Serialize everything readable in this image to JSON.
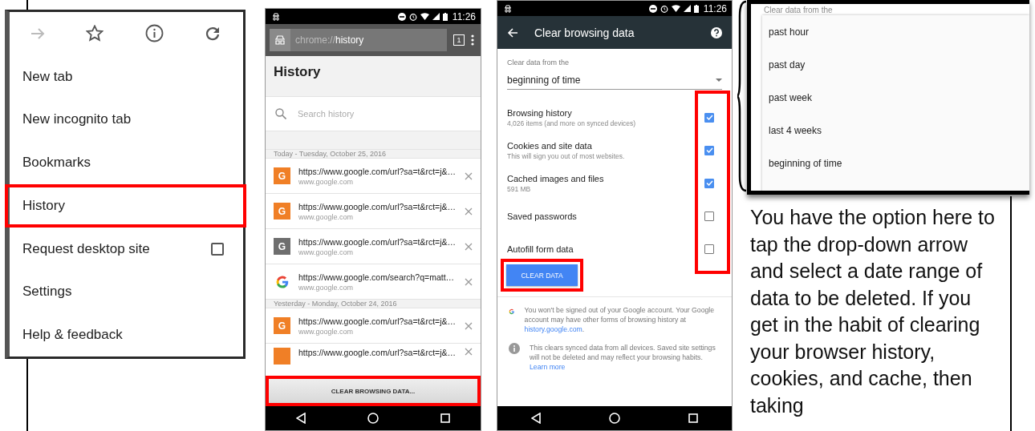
{
  "menu_screen": {
    "toolbar": [
      {
        "kind": "forward",
        "disabled": true
      },
      {
        "kind": "star",
        "disabled": false
      },
      {
        "kind": "info",
        "disabled": false
      },
      {
        "kind": "refresh",
        "disabled": false
      }
    ],
    "items": [
      {
        "label": "New tab",
        "kind": "item",
        "highlighted": false
      },
      {
        "label": "New incognito tab",
        "kind": "item",
        "highlighted": false
      },
      {
        "label": "Bookmarks",
        "kind": "item",
        "highlighted": false
      },
      {
        "label": "History",
        "kind": "item",
        "highlighted": true
      },
      {
        "label": "Request desktop site",
        "kind": "checkbox",
        "checked": false,
        "highlighted": false
      },
      {
        "label": "Settings",
        "kind": "item",
        "highlighted": false
      },
      {
        "label": "Help & feedback",
        "kind": "item",
        "highlighted": false
      }
    ]
  },
  "history_screen": {
    "status_time": "11:26",
    "url_scheme": "chrome://",
    "url_path": "history",
    "tab_count": "1",
    "title": "History",
    "search_placeholder": "Search history",
    "groups": [
      {
        "date": "Today - Tuesday, October 25, 2016",
        "entries": [
          {
            "kind": "letter",
            "letter": "G",
            "color": "#f07f26",
            "url": "https://www.google.com/url?sa=t&rct=j&…",
            "domain": "www.google.com"
          },
          {
            "kind": "letter",
            "letter": "G",
            "color": "#f07f26",
            "url": "https://www.google.com/url?sa=t&rct=j&…",
            "domain": "www.google.com"
          },
          {
            "kind": "letter",
            "letter": "G",
            "color": "#6e6e6e",
            "url": "https://www.google.com/url?sa=t&rct=j&…",
            "domain": "www.google.com"
          },
          {
            "kind": "google",
            "url": "https://www.google.com/search?q=matt…",
            "domain": "www.google.com"
          }
        ]
      },
      {
        "date": "Yesterday - Monday, October 24, 2016",
        "entries": [
          {
            "kind": "letter",
            "letter": "G",
            "color": "#f07f26",
            "url": "https://www.google.com/url?sa=t&rct=j&…",
            "domain": "www.google.com"
          },
          {
            "kind": "letter",
            "color": "#f07f26",
            "url": "https://www.google.com/url?sa=t&rct=j&…"
          }
        ]
      }
    ],
    "footer_button": {
      "label": "CLEAR BROWSING DATA...",
      "highlighted": true
    }
  },
  "clear_screen": {
    "status_time": "11:26",
    "title": "Clear browsing data",
    "field_label": "Clear data from the",
    "field_value": "beginning of time",
    "checkboxes_highlighted": true,
    "options": [
      {
        "title": "Browsing history",
        "subtitle": "4,026 items (and more on synced devices)",
        "checked": true
      },
      {
        "title": "Cookies and site data",
        "subtitle": "This will sign you out of most websites.",
        "checked": true
      },
      {
        "title": "Cached images and files",
        "subtitle": "591 MB",
        "checked": true
      },
      {
        "title": "Saved passwords",
        "checked": false
      },
      {
        "title": "Autofill form data",
        "checked": false
      }
    ],
    "button": {
      "label": "CLEAR DATA",
      "highlighted": true
    },
    "notes": [
      {
        "kind": "google",
        "text": "You won't be signed out of your Google account. Your Google account may have other forms of browsing history at ",
        "link": "history.google.com",
        "after": "."
      },
      {
        "kind": "info",
        "text": "This clears synced data from all devices. Saved site settings will not be deleted and may reflect your browsing habits. ",
        "link": "Learn more"
      }
    ]
  },
  "dropdown": {
    "label": "Clear data from the",
    "options": [
      "past hour",
      "past day",
      "past week",
      "last 4 weeks",
      "beginning of time"
    ]
  },
  "caption": "You have the option here to tap the drop-down arrow and select a date range of data to be deleted. If you get in the habit of clearing your browser history, cookies, and cache, then taking"
}
